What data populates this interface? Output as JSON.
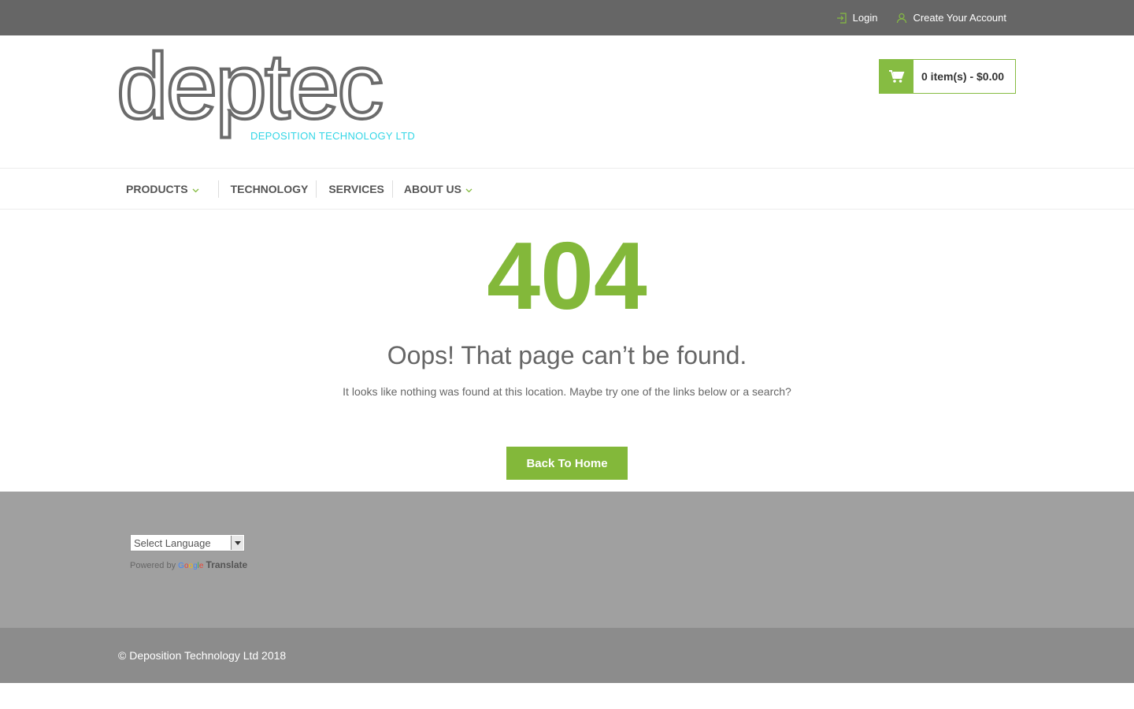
{
  "topbar": {
    "login_label": "Login",
    "create_account_label": "Create Your Account"
  },
  "header": {
    "logo_word": "deptec",
    "logo_tagline": "DEPOSITION TECHNOLOGY LTD",
    "cart_label": "0 item(s) - $0.00"
  },
  "nav": {
    "items": [
      {
        "label": "PRODUCTS"
      },
      {
        "label": "TECHNOLOGY"
      },
      {
        "label": "SERVICES"
      },
      {
        "label": "ABOUT US"
      }
    ]
  },
  "main": {
    "code": "404",
    "heading": "Oops! That page can’t be found.",
    "message": "It looks like nothing was found at this location. Maybe try one of the links below or a search?",
    "button_label": "Back To Home"
  },
  "footer": {
    "language_select_value": "Select Language",
    "powered_by": "Powered by",
    "google": "Google",
    "translate": "Translate",
    "copyright": "© Deposition Technology Ltd 2018"
  },
  "colors": {
    "accent": "#83b83a",
    "topbar": "#666666",
    "footer": "#a0a0a0",
    "bottom_bar": "#8c8c8c",
    "logo_tagline": "#33d6e6"
  }
}
